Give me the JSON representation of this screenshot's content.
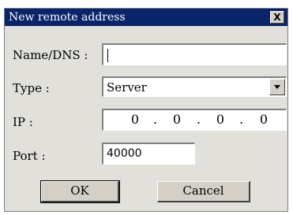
{
  "window": {
    "title": "New remote address",
    "close_glyph": "X"
  },
  "form": {
    "name_label": "Name/DNS :",
    "name_value": "",
    "type_label": "Type :",
    "type_value": "Server",
    "ip_label": "IP :",
    "ip_octets": [
      "0",
      "0",
      "0",
      "0"
    ],
    "ip_separator": ".",
    "port_label": "Port :",
    "port_value": "40000"
  },
  "buttons": {
    "ok": "OK",
    "cancel": "Cancel"
  },
  "icons": {
    "close": "close-icon",
    "dropdown": "chevron-down-icon"
  },
  "colors": {
    "titlebar": "#0a246a",
    "dialog_bg": "#e2e0da",
    "field_bg": "#ffffff"
  }
}
